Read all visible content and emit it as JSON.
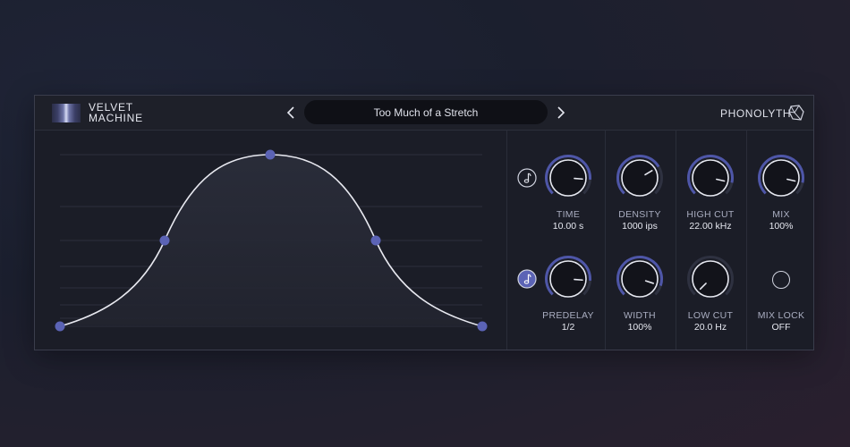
{
  "header": {
    "brand_line1": "VELVET",
    "brand_line2": "MACHINE",
    "preset_name": "Too Much of a Stretch",
    "company": "PHONOLYTH"
  },
  "params": {
    "time": {
      "label": "TIME",
      "value": "10.00 s",
      "level": 0.85
    },
    "density": {
      "label": "DENSITY",
      "value": "1000 ips",
      "level": 0.72
    },
    "high_cut": {
      "label": "HIGH CUT",
      "value": "22.00 kHz",
      "level": 0.88
    },
    "mix": {
      "label": "MIX",
      "value": "100%",
      "level": 0.88
    },
    "predelay": {
      "label": "PREDELAY",
      "value": "1/2",
      "level": 0.85
    },
    "width": {
      "label": "WIDTH",
      "value": "100%",
      "level": 0.9
    },
    "low_cut": {
      "label": "LOW CUT",
      "value": "20.0 Hz",
      "level": 0.0
    },
    "mix_lock": {
      "label": "MIX LOCK",
      "value": "OFF"
    }
  },
  "colors": {
    "accent": "#6b73c9",
    "knob_ring": "#4e56a8",
    "curve": "#e8e9f0",
    "node": "#5b63b5"
  },
  "icons": {
    "time_sync": "music-note-icon",
    "predelay_sync": "music-note-icon",
    "prev": "chevron-left-icon",
    "next": "chevron-right-icon",
    "company_logo": "phonolyth-logo-icon"
  }
}
